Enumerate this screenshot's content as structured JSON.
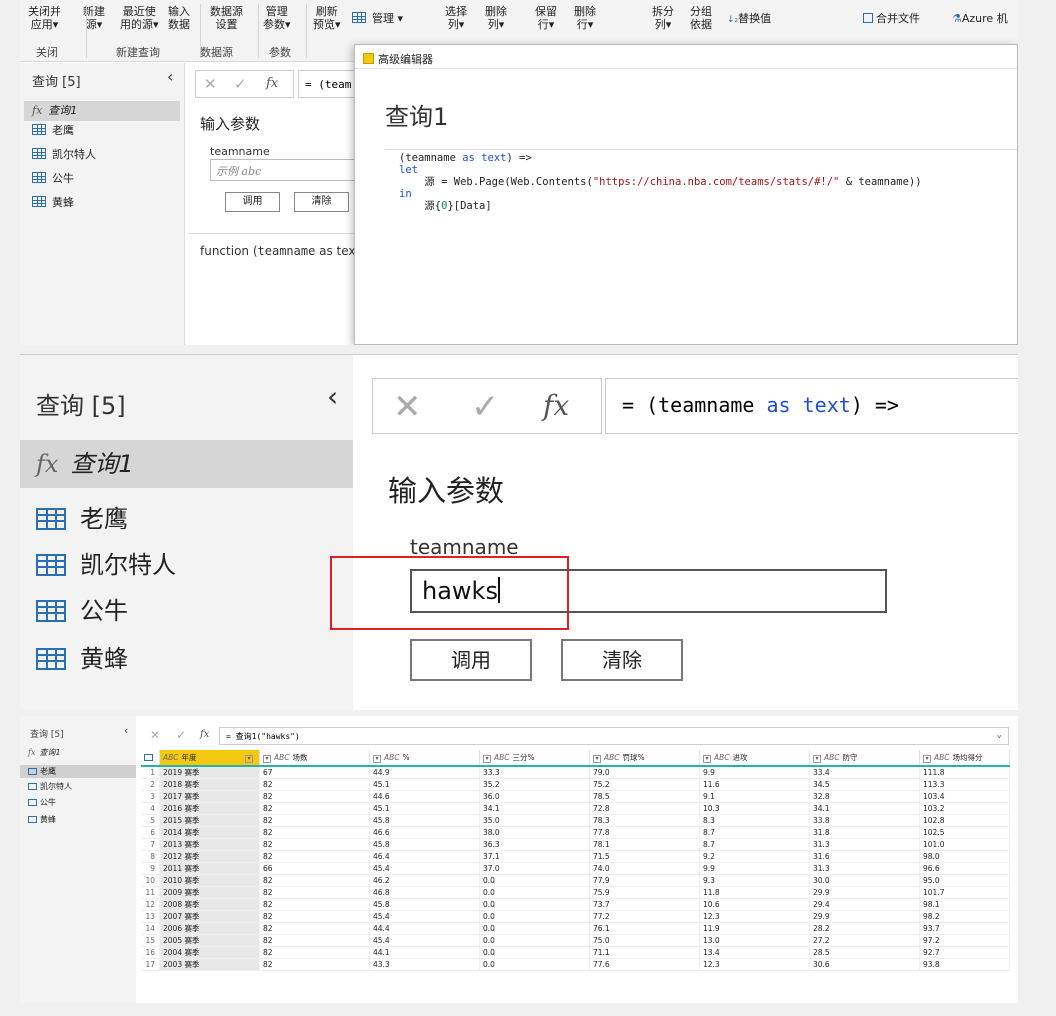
{
  "ribbon": {
    "buttons": [
      {
        "label": "关闭并\n应用▾"
      },
      {
        "label": "新建\n源▾"
      },
      {
        "label": "最近使\n用的源▾"
      },
      {
        "label": "输入\n数据"
      },
      {
        "label": "数据源\n设置"
      },
      {
        "label": "管理\n参数▾"
      },
      {
        "label": "刷新\n预览▾"
      },
      {
        "label": "选择\n列▾"
      },
      {
        "label": "删除\n列▾"
      },
      {
        "label": "保留\n行▾"
      },
      {
        "label": "删除\n行▾"
      },
      {
        "label": "拆分\n列▾"
      },
      {
        "label": "分组\n依据"
      }
    ],
    "manage_label": "管理 ▾",
    "replace_label": "替换值",
    "merge_files_label": "合并文件",
    "azure_label": "Azure 机",
    "groups": [
      "关闭",
      "新建查询",
      "数据源",
      "参数"
    ]
  },
  "queries": {
    "header": "查询 [5]",
    "items": [
      {
        "label": "查询1",
        "type": "function",
        "selected": true
      },
      {
        "label": "老鹰",
        "type": "table"
      },
      {
        "label": "凯尔特人",
        "type": "table"
      },
      {
        "label": "公牛",
        "type": "table"
      },
      {
        "label": "黄蜂",
        "type": "table"
      }
    ]
  },
  "formula": {
    "text": "= (teamname as text) =>",
    "short": "= (team"
  },
  "parameters": {
    "title": "输入参数",
    "param_name": "teamname",
    "placeholder": "示例 abc",
    "value": "hawks",
    "invoke_label": "调用",
    "clear_label": "清除",
    "function_text": "function (",
    "function_mono": "teamname",
    "function_tail": " as tex"
  },
  "advanced_editor": {
    "window_title": "高级编辑器",
    "heading": "查询1",
    "code_lines": [
      "(teamname as text) =>",
      "let",
      "    源 = Web.Page(Web.Contents(\"https://china.nba.com/teams/stats/#!/\" & teamname))",
      "in",
      "    源{0}[Data]"
    ]
  },
  "result": {
    "formula": "= 查询1(\"hawks\")",
    "queries": [
      {
        "label": "查询1",
        "type": "function"
      },
      {
        "label": "老鹰",
        "type": "table",
        "selected": true
      },
      {
        "label": "凯尔特人",
        "type": "table"
      },
      {
        "label": "公牛",
        "type": "table"
      },
      {
        "label": "黄蜂",
        "type": "table"
      }
    ],
    "type_prefix": "ABC",
    "columns": [
      "年度",
      "场数",
      "%",
      "三分%",
      "罚球%",
      "进攻",
      "防守",
      "场均得分"
    ],
    "rows": [
      [
        "2019 赛季",
        "67",
        "44.9",
        "33.3",
        "79.0",
        "9.9",
        "33.4",
        "111.8"
      ],
      [
        "2018 赛季",
        "82",
        "45.1",
        "35.2",
        "75.2",
        "11.6",
        "34.5",
        "113.3"
      ],
      [
        "2017 赛季",
        "82",
        "44.6",
        "36.0",
        "78.5",
        "9.1",
        "32.8",
        "103.4"
      ],
      [
        "2016 赛季",
        "82",
        "45.1",
        "34.1",
        "72.8",
        "10.3",
        "34.1",
        "103.2"
      ],
      [
        "2015 赛季",
        "82",
        "45.8",
        "35.0",
        "78.3",
        "8.3",
        "33.8",
        "102.8"
      ],
      [
        "2014 赛季",
        "82",
        "46.6",
        "38.0",
        "77.8",
        "8.7",
        "31.8",
        "102.5"
      ],
      [
        "2013 赛季",
        "82",
        "45.8",
        "36.3",
        "78.1",
        "8.7",
        "31.3",
        "101.0"
      ],
      [
        "2012 赛季",
        "82",
        "46.4",
        "37.1",
        "71.5",
        "9.2",
        "31.6",
        "98.0"
      ],
      [
        "2011 赛季",
        "66",
        "45.4",
        "37.0",
        "74.0",
        "9.9",
        "31.3",
        "96.6"
      ],
      [
        "2010 赛季",
        "82",
        "46.2",
        "0.0",
        "77.9",
        "9.3",
        "30.0",
        "95.0"
      ],
      [
        "2009 赛季",
        "82",
        "46.8",
        "0.0",
        "75.9",
        "11.8",
        "29.9",
        "101.7"
      ],
      [
        "2008 赛季",
        "82",
        "45.8",
        "0.0",
        "73.7",
        "10.6",
        "29.4",
        "98.1"
      ],
      [
        "2007 赛季",
        "82",
        "45.4",
        "0.0",
        "77.2",
        "12.3",
        "29.9",
        "98.2"
      ],
      [
        "2006 赛季",
        "82",
        "44.4",
        "0.0",
        "76.1",
        "11.9",
        "28.2",
        "93.7"
      ],
      [
        "2005 赛季",
        "82",
        "45.4",
        "0.0",
        "75.0",
        "13.0",
        "27.2",
        "97.2"
      ],
      [
        "2004 赛季",
        "82",
        "44.1",
        "0.0",
        "71.1",
        "13.4",
        "28.5",
        "92.7"
      ],
      [
        "2003 赛季",
        "82",
        "43.3",
        "0.0",
        "77.6",
        "12.3",
        "30.6",
        "93.8"
      ]
    ]
  },
  "colors": {
    "accent": "#f2c811",
    "highlight_border": "#e02020",
    "header_underline": "#25b3a8",
    "table_icon": "#2a6fb6"
  }
}
